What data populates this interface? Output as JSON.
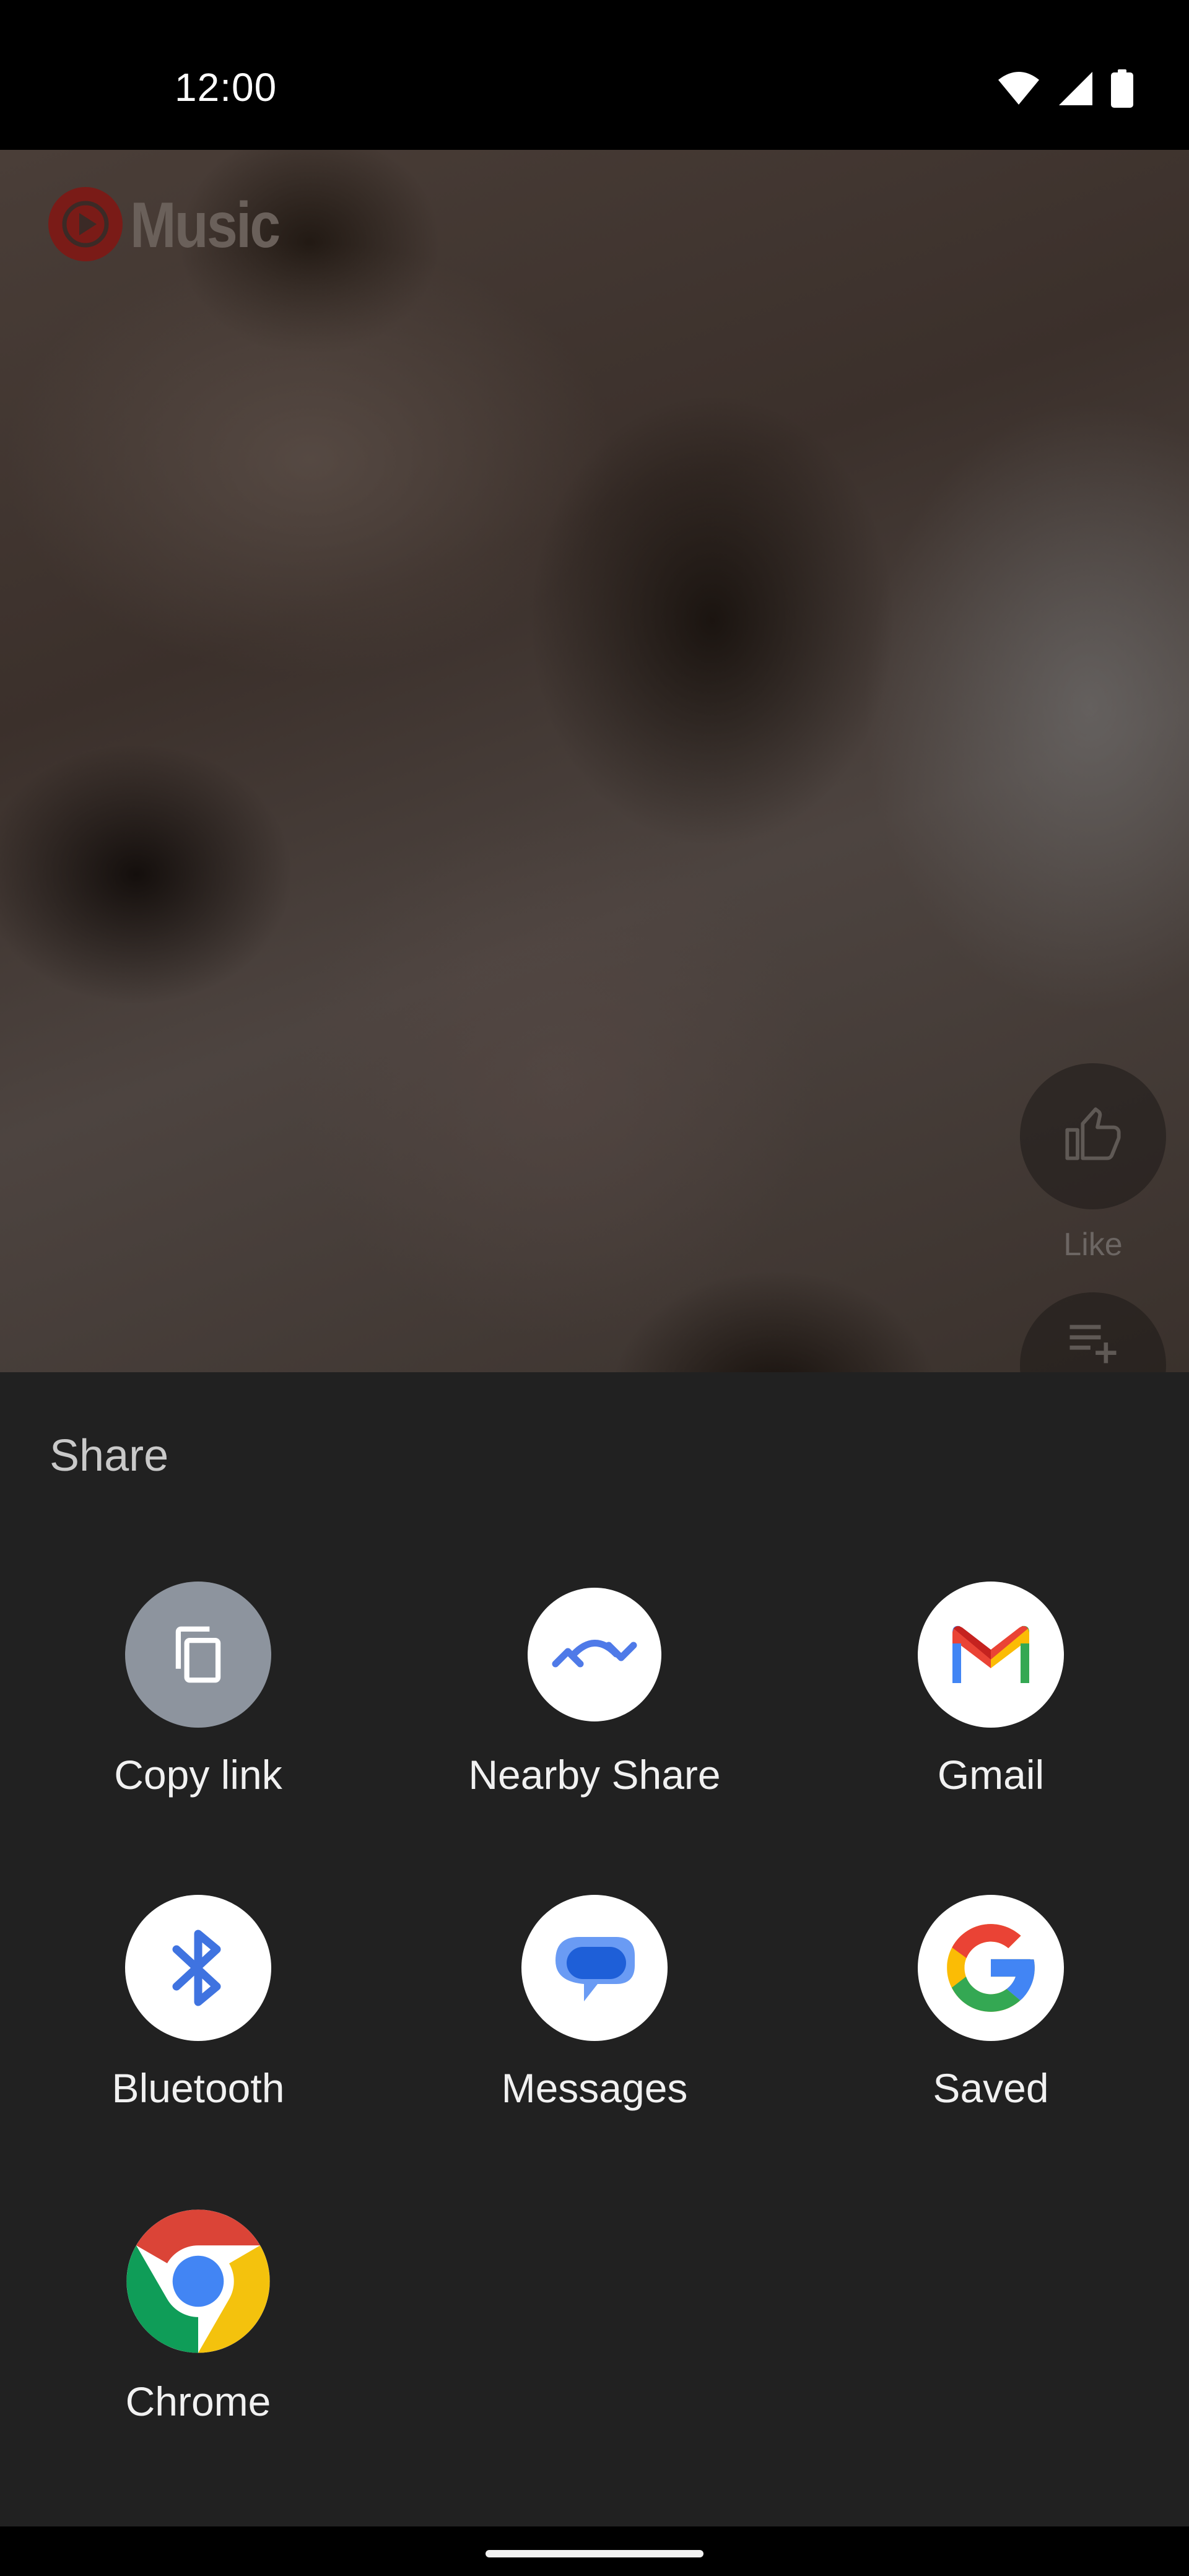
{
  "status_bar": {
    "time": "12:00",
    "icons": [
      "wifi-icon",
      "cellular-signal-icon",
      "battery-icon"
    ]
  },
  "background_app": {
    "logo_text": "Music",
    "logo_color": "#c4302b",
    "side_actions": [
      {
        "icon": "thumbs-up-icon",
        "label": "Like"
      },
      {
        "icon": "add-to-queue-icon",
        "label": ""
      }
    ]
  },
  "share_sheet": {
    "title": "Share",
    "targets": [
      {
        "label": "Copy link",
        "icon": "copy-icon"
      },
      {
        "label": "Nearby Share",
        "icon": "nearby-share-icon"
      },
      {
        "label": "Gmail",
        "icon": "gmail-icon"
      },
      {
        "label": "Bluetooth",
        "icon": "bluetooth-icon"
      },
      {
        "label": "Messages",
        "icon": "messages-icon"
      },
      {
        "label": "Saved",
        "icon": "google-g-icon"
      },
      {
        "label": "Chrome",
        "icon": "chrome-icon"
      }
    ]
  },
  "colors": {
    "sheet_background": "#212121",
    "copy_link_icon_bg": "#8d949e",
    "google_blue": "#4285f4",
    "google_red": "#ea4335",
    "google_yellow": "#fbbc05",
    "google_green": "#34a853"
  }
}
